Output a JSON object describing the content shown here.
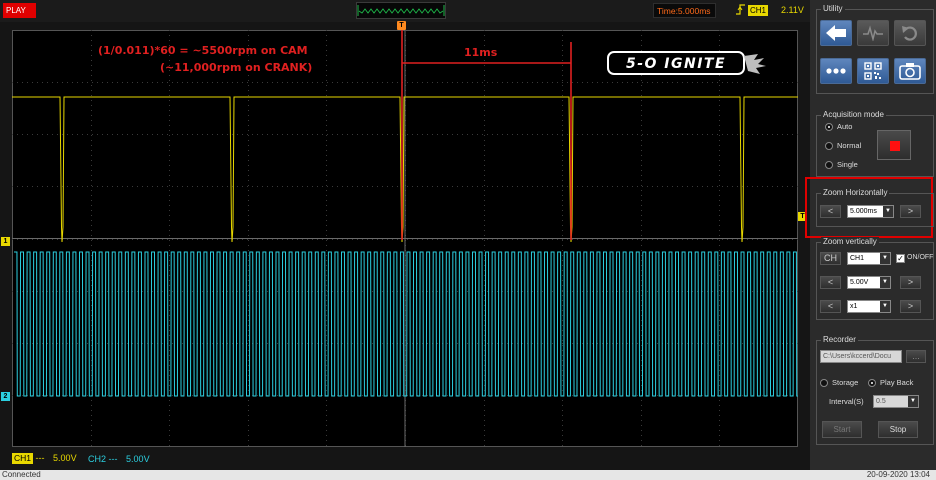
{
  "topbar": {
    "play_label": "PLAY",
    "time_label": "Time:5.000ms",
    "trigger_channel": "CH1",
    "trigger_level": "2.11V",
    "trigger_edge_icon": "rising-edge-icon"
  },
  "screen": {
    "annotation_line1": "(1/0.011)*60 = ~5500rpm on CAM",
    "annotation_line2": "(~11,000rpm on CRANK)",
    "period_label": "11ms",
    "logo_text": "5-O IGNITE",
    "trigger_marker": "T",
    "ch1_marker": "1",
    "ch2_marker": "2",
    "trig_level_marker": "T",
    "ch1_color": "#e8d800",
    "ch2_color": "#2ccfe0"
  },
  "channels_status": {
    "ch1_tag": "CH1",
    "ch1_coupling": "---",
    "ch1_scale": "5.00V",
    "ch2_label": "CH2",
    "ch2_coupling": "---",
    "ch2_scale": "5.00V"
  },
  "panel": {
    "utility_title": "Utility",
    "utility_icons": [
      "back-arrow-icon",
      "waveform-icon",
      "undo-icon",
      "more-icon",
      "qr-code-icon",
      "camera-icon"
    ],
    "acquisition": {
      "title": "Acquisition mode",
      "options": [
        "Auto",
        "Normal",
        "Single"
      ],
      "selected": "Auto"
    },
    "zoom_h": {
      "title": "Zoom Horizontally",
      "value": "5.000ms",
      "prev": "<",
      "next": ">"
    },
    "zoom_v": {
      "title": "Zoom vertically",
      "ch_button": "CH",
      "channel": "CH1",
      "onoff_label": "ON/OFF",
      "volts": "5.00V",
      "probe": "x1",
      "prev": "<",
      "next": ">"
    },
    "recorder": {
      "title": "Recorder",
      "path": "C:\\Users\\kccerd\\Docu",
      "browse": "...",
      "options": [
        "Storage",
        "Play Back"
      ],
      "selected": "Play Back",
      "interval_label": "Interval(S)",
      "interval_value": "0.5",
      "start": "Start",
      "stop": "Stop"
    },
    "highlight_color": "#e00000"
  },
  "statusbar": {
    "left": "Connected",
    "right": "20-09-2020  13:04"
  }
}
